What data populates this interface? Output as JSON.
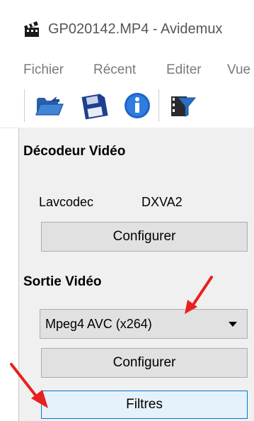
{
  "window": {
    "title": "GP020142.MP4 - Avidemux",
    "icon": "clapperboard-icon"
  },
  "menu": [
    "Fichier",
    "Récent",
    "Editer",
    "Vue"
  ],
  "toolbar": {
    "buttons": [
      "open-folder-icon",
      "save-floppy-icon",
      "info-icon",
      "filter-funnel-icon"
    ]
  },
  "decoder": {
    "title": "Décodeur Vidéo",
    "codec": "Lavcodec",
    "hw": "DXVA2",
    "configure_label": "Configurer"
  },
  "output": {
    "title": "Sortie Vidéo",
    "selected": "Mpeg4 AVC (x264)",
    "configure_label": "Configurer",
    "filters_label": "Filtres"
  },
  "colors": {
    "panel_bg": "#f0f0f0",
    "button_bg": "#e1e1e1",
    "focus_border": "#0078d7",
    "annotation_arrow": "#e8211d"
  }
}
